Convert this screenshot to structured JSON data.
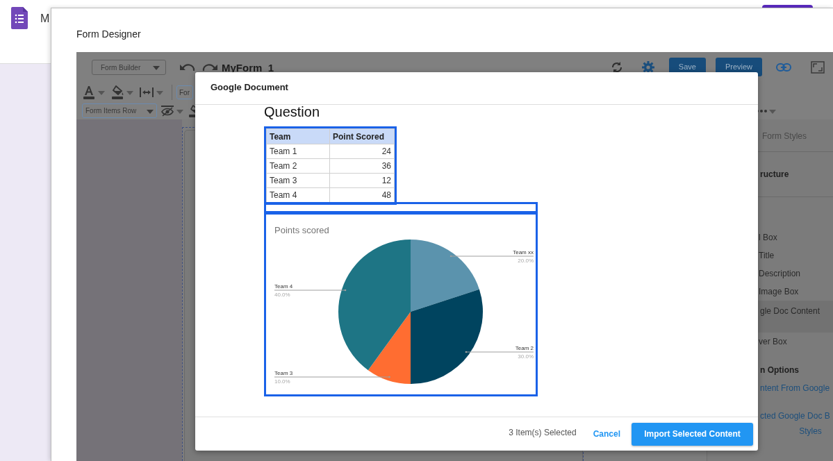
{
  "app": {
    "header_initial": "M"
  },
  "designer": {
    "title": "Form Designer",
    "toolbar": {
      "mode": "Form Builder",
      "form_name": "MyForm_1",
      "buttons": [
        {
          "label": "Save"
        },
        {
          "label": "Preview"
        }
      ],
      "font_box": "For",
      "row_layout": "Form Items Row"
    },
    "side_panel": {
      "tab": "Form Styles",
      "section": "ructure",
      "items": [
        {
          "label": "l Box",
          "selected": false
        },
        {
          "label": "Title",
          "selected": false
        },
        {
          "label": "Description",
          "selected": false
        },
        {
          "label": "Image Box",
          "selected": false
        },
        {
          "label": "gle Doc Content",
          "selected": true
        },
        {
          "label": "ver Box",
          "selected": false
        }
      ],
      "options_heading": "n Options",
      "links": [
        {
          "lines": [
            "ntent From Google"
          ]
        },
        {
          "lines": [
            "cted Google Doc B",
            "Styles"
          ]
        }
      ]
    }
  },
  "dialog": {
    "title": "Google Document",
    "blocks": [
      {
        "kind": "heading",
        "text": "Question",
        "selected": false
      },
      {
        "kind": "table",
        "selected": true,
        "columns": [
          "Team",
          "Point Scored"
        ],
        "rows": [
          [
            "Team 1",
            "24"
          ],
          [
            "Team 2",
            "36"
          ],
          [
            "Team 3",
            "12"
          ],
          [
            "Team 4",
            "48"
          ]
        ]
      },
      {
        "kind": "paragraph",
        "selected": true
      },
      {
        "kind": "chart",
        "selected": true,
        "chart_data": {
          "type": "pie",
          "title": "Points scored",
          "categories": [
            "Team xx",
            "Team 2",
            "Team 3",
            "Team 4"
          ],
          "values": [
            20,
            30,
            10,
            40
          ],
          "colors": [
            "#5b93ad",
            "#00445f",
            "#ff6d31",
            "#1e7585"
          ],
          "value_labels": [
            "20.0%",
            "30.0%",
            "10.0%",
            "40.0%"
          ]
        }
      }
    ],
    "footer": {
      "status": "3 Item(s) Selected",
      "cancel": "Cancel",
      "confirm": "Import Selected Content"
    }
  }
}
